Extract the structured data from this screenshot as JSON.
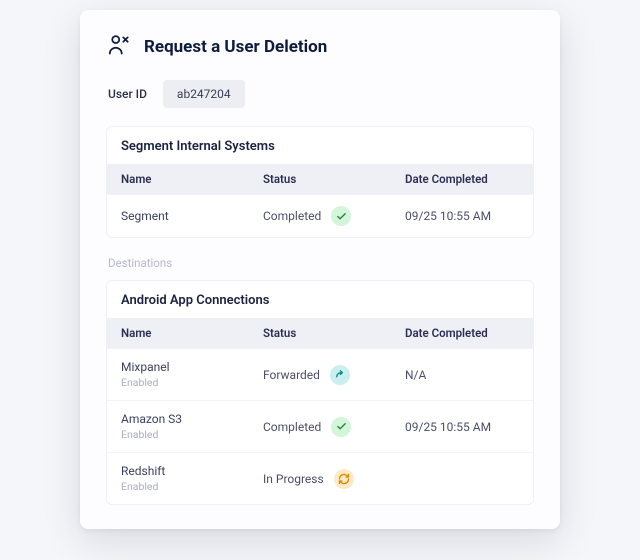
{
  "header": {
    "title": "Request a User Deletion"
  },
  "user": {
    "label": "User ID",
    "value": "ab247204"
  },
  "columns": {
    "name": "Name",
    "status": "Status",
    "date": "Date Completed"
  },
  "internal": {
    "title": "Segment Internal Systems",
    "rows": [
      {
        "name": "Segment",
        "sub": "",
        "status": "Completed",
        "icon": "check",
        "date": "09/25 10:55 AM"
      }
    ]
  },
  "destinations_label": "Destinations",
  "android": {
    "title": "Android App Connections",
    "rows": [
      {
        "name": "Mixpanel",
        "sub": "Enabled",
        "status": "Forwarded",
        "icon": "forward",
        "date": "N/A"
      },
      {
        "name": "Amazon S3",
        "sub": "Enabled",
        "status": "Completed",
        "icon": "check",
        "date": "09/25 10:55 AM"
      },
      {
        "name": "Redshift",
        "sub": "Enabled",
        "status": "In Progress",
        "icon": "refresh",
        "date": ""
      }
    ]
  }
}
